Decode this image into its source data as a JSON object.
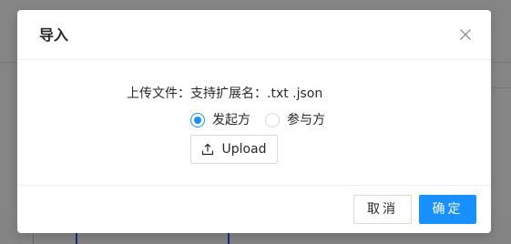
{
  "dialog": {
    "title": "导入",
    "close_icon": "close-icon"
  },
  "body": {
    "upload_label": "上传文件：支持扩展名：.txt .json",
    "radio_options": [
      {
        "label": "发起方",
        "checked": true
      },
      {
        "label": "参与方",
        "checked": false
      }
    ],
    "upload_button_label": "Upload",
    "upload_icon": "upload-icon"
  },
  "footer": {
    "cancel_label": "取消",
    "ok_label": "确定"
  },
  "colors": {
    "primary": "#1890ff",
    "mask": "rgba(0,0,0,0.45)",
    "border": "#d9d9d9"
  }
}
